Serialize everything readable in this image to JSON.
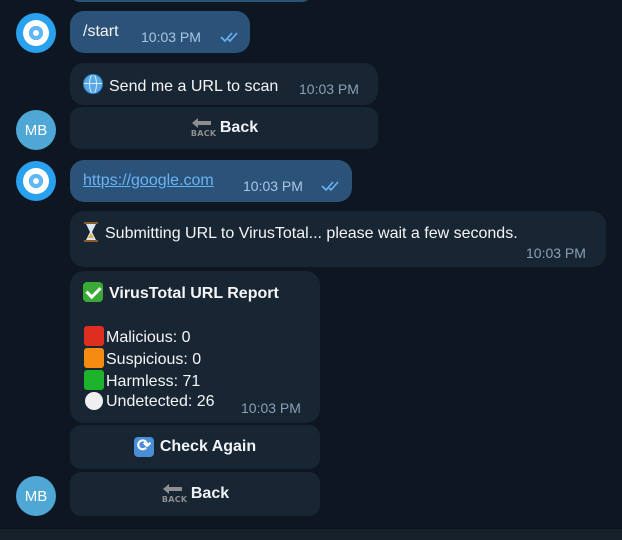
{
  "messages": {
    "m1": {
      "text": "/start",
      "time": "10:03 PM"
    },
    "m2": {
      "text": "Send me a URL to scan",
      "time": "10:03 PM",
      "button": "Back",
      "button_glyph_word": "BACK"
    },
    "m3": {
      "text": "https://google.com",
      "time": "10:03 PM"
    },
    "m4": {
      "text": "Submitting URL to VirusTotal... please wait a few seconds.",
      "time": "10:03 PM"
    },
    "m5": {
      "title": "VirusTotal URL Report",
      "malicious": "Malicious: 0",
      "suspicious": "Suspicious: 0",
      "harmless": "Harmless: 71",
      "undetected": "Undetected: 26",
      "time": "10:03 PM",
      "button_check": "Check Again",
      "button_back": "Back",
      "button_glyph_word": "BACK"
    }
  },
  "avatars": {
    "user_initials": "MB"
  },
  "icons": {
    "bot_avatar": "bot-logo-icon",
    "read": "double-check-icon",
    "globe": "globe-icon",
    "hourglass": "hourglass-icon",
    "check": "check-mark-icon",
    "refresh": "refresh-icon",
    "back": "back-arrow-icon"
  },
  "colors": {
    "background": "#0e1621",
    "outgoing_bubble": "#2b5278",
    "incoming_bubble": "#182533",
    "link": "#6ab3f3",
    "malicious": "#dd2e1f",
    "suspicious": "#f58b10",
    "harmless": "#1db32b"
  }
}
